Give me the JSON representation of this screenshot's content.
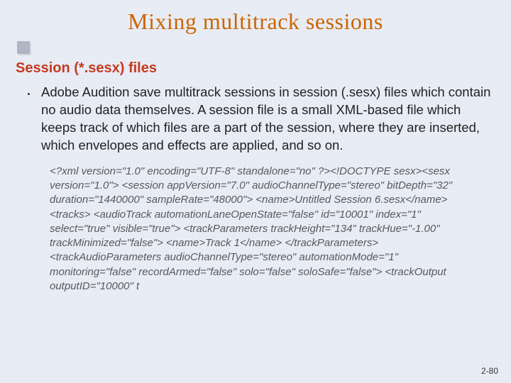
{
  "title": "Mixing multitrack sessions",
  "subhead": "Session (*.sesx) files",
  "bullet": "Adobe Audition save multitrack sessions in session (.sesx) files which contain no audio data themselves. A session file is a small XML-based file which keeps track of which files are a part of the session, where they are inserted, which envelopes and effects are applied, and so on.",
  "code": "<?xml version=\"1.0\" encoding=\"UTF-8\" standalone=\"no\" ?><!DOCTYPE sesx><sesx version=\"1.0\">   <session appVersion=\"7.0\" audioChannelType=\"stereo\" bitDepth=\"32\" duration=\"1440000\" sampleRate=\"48000\">     <name>Untitled Session 6.sesx</name>     <tracks>       <audioTrack automationLaneOpenState=\"false\" id=\"10001\" index=\"1\" select=\"true\" visible=\"true\">         <trackParameters trackHeight=\"134\" trackHue=\"-1.00\" trackMinimized=\"false\">           <name>Track 1</name>         </trackParameters>         <trackAudioParameters audioChannelType=\"stereo\" automationMode=\"1\" monitoring=\"false\" recordArmed=\"false\" solo=\"false\" soloSafe=\"false\">           <trackOutput outputID=\"10000\" t",
  "pagenum": "2-80"
}
